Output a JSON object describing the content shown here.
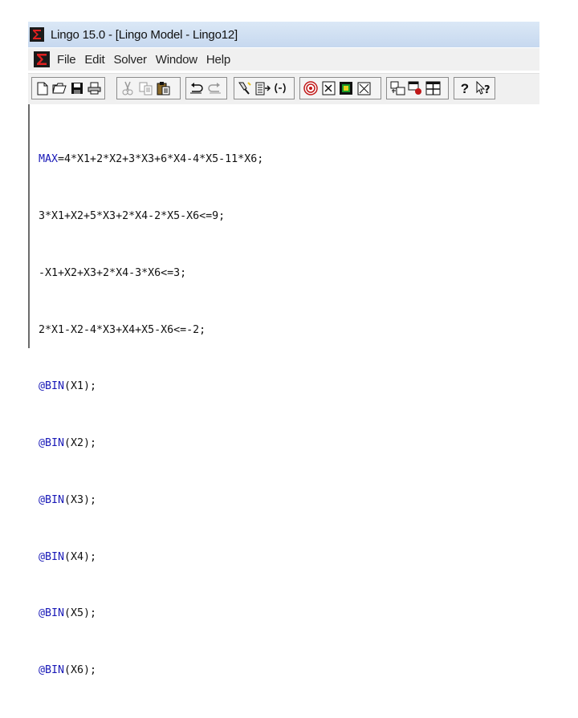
{
  "window": {
    "title": "Lingo 15.0 - [Lingo Model - Lingo12]"
  },
  "menu": {
    "items": [
      "File",
      "Edit",
      "Solver",
      "Window",
      "Help"
    ]
  },
  "toolbar": {
    "icons": [
      "new-file-icon",
      "open-folder-icon",
      "save-icon",
      "print-icon",
      "cut-icon",
      "copy-icon",
      "paste-icon",
      "undo-icon",
      "redo-icon",
      "find-icon",
      "go-to-line-icon",
      "match-parenthesis-icon",
      "solve-icon",
      "solution-icon",
      "options-icon",
      "close-all-icon",
      "tile-icon",
      "send-to-back-icon",
      "window-list-icon",
      "help-icon",
      "context-help-icon"
    ]
  },
  "editor": {
    "lines": [
      {
        "kw": "MAX",
        "rest": "=4*X1+2*X2+3*X3+6*X4-4*X5-11*X6;"
      },
      {
        "kw": "",
        "rest": "3*X1+X2+5*X3+2*X4-2*X5-X6<=9;"
      },
      {
        "kw": "",
        "rest": "-X1+X2+X3+2*X4-3*X6<=3;"
      },
      {
        "kw": "",
        "rest": "2*X1-X2-4*X3+X4+X5-X6<=-2;"
      },
      {
        "kw": "@BIN",
        "rest": "(X1);"
      },
      {
        "kw": "@BIN",
        "rest": "(X2);"
      },
      {
        "kw": "@BIN",
        "rest": "(X3);"
      },
      {
        "kw": "@BIN",
        "rest": "(X4);"
      },
      {
        "kw": "@BIN",
        "rest": "(X5);"
      },
      {
        "kw": "@BIN",
        "rest": "(X6);"
      }
    ]
  }
}
